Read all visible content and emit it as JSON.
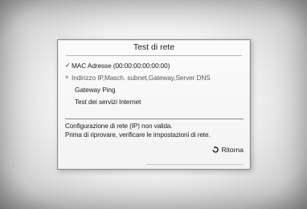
{
  "dialog": {
    "title": "Test di rete",
    "tests": [
      {
        "mark": "✓",
        "label": "MAC Adresse (00:00:00:00:00:00)",
        "status": "passed"
      },
      {
        "mark": "×",
        "label": "Indirizzo IP,Masch. subnet,Gateway,Server DNS",
        "status": "failed"
      },
      {
        "mark": "",
        "label": "Gateway Ping",
        "status": "pending"
      },
      {
        "mark": "",
        "label": "Test dei servizi Internet",
        "status": "pending"
      }
    ],
    "message_line1": "Configurazione di rete (IP) non valida.",
    "message_line2": "Prima di riprovare, verificare le impostazioni di rete.",
    "return_label": "Ritorna",
    "return_icon": "return-arrow-icon"
  }
}
